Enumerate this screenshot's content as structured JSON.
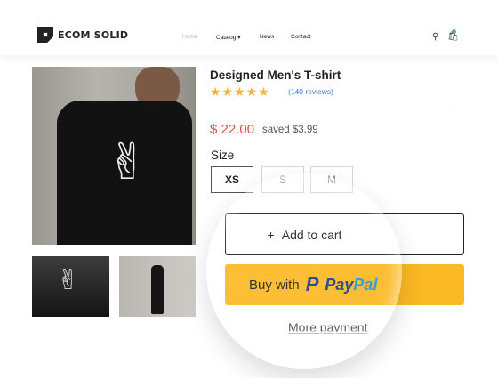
{
  "header": {
    "logo_text": "ECOM SOLID",
    "nav": {
      "home": "Home",
      "catalog": "Catalog ▾",
      "news": "News",
      "contact": "Contact"
    },
    "icons": [
      "search-icon",
      "cart-icon"
    ]
  },
  "product": {
    "title": "Designed Men's T-shirt",
    "stars": "★★★★★",
    "reviews": "(140 reviews)",
    "price": "$ 22.00",
    "saved": "saved $3.99",
    "size_label": "Size",
    "sizes": [
      "XS",
      "S",
      "M"
    ],
    "selected_size": "XS",
    "add_to_cart": "Add to cart",
    "add_to_cart_icon": "+",
    "buy_with": "Buy with",
    "paypal_pay": "Pay",
    "paypal_pal": "Pal",
    "more_payment": "More payment"
  },
  "colors": {
    "price": "#e54b4b",
    "reviews_link": "#3a7bd5",
    "stars": "#f5b72a",
    "paypal_button": "#fbb924"
  }
}
